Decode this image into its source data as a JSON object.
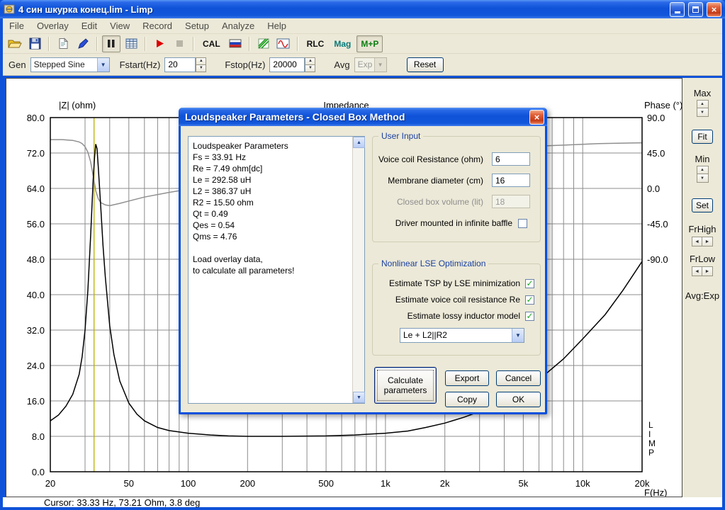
{
  "window": {
    "title": "4 син шкурка конец.lim - Limp"
  },
  "menu": {
    "items": [
      "File",
      "Overlay",
      "Edit",
      "View",
      "Record",
      "Setup",
      "Analyze",
      "Help"
    ]
  },
  "toolbar": {
    "cal_label": "CAL",
    "rlc_label": "RLC",
    "mag_label": "Mag",
    "mp_label": "M+P"
  },
  "genbar": {
    "gen_label": "Gen",
    "gen_value": "Stepped Sine",
    "fstart_label": "Fstart(Hz)",
    "fstart_value": "20",
    "fstop_label": "Fstop(Hz)",
    "fstop_value": "20000",
    "avg_label": "Avg",
    "avg_value": "Exp",
    "reset_label": "Reset"
  },
  "right_panel": {
    "max_label": "Max",
    "fit_label": "Fit",
    "min_label": "Min",
    "set_label": "Set",
    "frhigh_label": "FrHigh",
    "frlow_label": "FrLow",
    "avg_exp_label": "Avg:Exp"
  },
  "statusbar": {
    "cursor_text": "Cursor: 33.33 Hz, 73.21 Ohm, 3.8 deg"
  },
  "dialog": {
    "title": "Loudspeaker Parameters - Closed Box Method",
    "results_lines": [
      "Loudspeaker Parameters",
      "Fs  = 33.91 Hz",
      "Re  = 7.49 ohm[dc]",
      "Le  = 292.58 uH",
      "L2  = 386.37 uH",
      "R2  = 15.50 ohm",
      "Qt  = 0.49",
      "Qes = 0.54",
      "Qms = 4.76",
      "",
      "Load overlay data,",
      "to calculate all parameters!"
    ],
    "user_input": {
      "title": "User Input",
      "rows": [
        {
          "label": "Voice coil Resistance (ohm)",
          "value": "6"
        },
        {
          "label": "Membrane diameter (cm)",
          "value": "16"
        },
        {
          "label": "Closed box volume (lit)",
          "value": "18"
        }
      ],
      "baffle_label": "Driver mounted in infinite baffle",
      "baffle_checked": false
    },
    "lse": {
      "title": "Nonlinear LSE Optimization",
      "checks": [
        {
          "label": "Estimate TSP by LSE minimization",
          "checked": true
        },
        {
          "label": "Estimate voice coil resistance Re",
          "checked": true
        },
        {
          "label": "Estimate lossy inductor model",
          "checked": true
        }
      ],
      "model_value": "Le + L2||R2"
    },
    "buttons": {
      "calculate": "Calculate parameters",
      "export": "Export",
      "cancel": "Cancel",
      "copy": "Copy",
      "ok": "OK"
    }
  },
  "chart_data": {
    "type": "line",
    "title": "Impedance",
    "grid": true,
    "grid_color": "#8c8c8c",
    "y_left": {
      "label": "|Z| (ohm)",
      "min": 0,
      "max": 80,
      "ticks": [
        "80.0",
        "72.0",
        "64.0",
        "56.0",
        "48.0",
        "40.0",
        "32.0",
        "24.0",
        "16.0",
        "8.0",
        "0.0"
      ]
    },
    "y_right": {
      "label": "Phase (°)",
      "min": -90,
      "max": 90,
      "ticks": [
        "90.0",
        "45.0",
        "0.0",
        "-45.0",
        "-90.0"
      ]
    },
    "x_axis": {
      "label": "F(Hz)",
      "scale": "log",
      "min": 20,
      "max": 20000,
      "ticks": [
        [
          20,
          "20"
        ],
        [
          50,
          "50"
        ],
        [
          100,
          "100"
        ],
        [
          200,
          "200"
        ],
        [
          500,
          "500"
        ],
        [
          1000,
          "1k"
        ],
        [
          2000,
          "2k"
        ],
        [
          5000,
          "5k"
        ],
        [
          10000,
          "10k"
        ],
        [
          20000,
          "20k"
        ]
      ]
    },
    "cursor": {
      "freq_hz": 33.33,
      "impedance_ohm": 73.21,
      "phase_deg": 3.8,
      "color": "#b8b000"
    },
    "watermark": [
      "L",
      "I",
      "M",
      "P"
    ],
    "series": [
      {
        "name": "phase",
        "axis": "right",
        "color": "#8f8f8f",
        "points": [
          [
            20,
            62
          ],
          [
            23,
            62
          ],
          [
            26,
            61
          ],
          [
            28,
            59
          ],
          [
            29,
            57
          ],
          [
            30,
            53
          ],
          [
            31,
            46
          ],
          [
            32,
            34
          ],
          [
            33,
            16
          ],
          [
            33.5,
            6
          ],
          [
            34,
            -3
          ],
          [
            35,
            -13
          ],
          [
            36,
            -18
          ],
          [
            38,
            -21
          ],
          [
            40,
            -22
          ],
          [
            45,
            -19
          ],
          [
            50,
            -16
          ],
          [
            60,
            -11
          ],
          [
            80,
            -5
          ],
          [
            100,
            -1
          ],
          [
            150,
            5
          ],
          [
            200,
            10
          ],
          [
            300,
            17
          ],
          [
            500,
            25
          ],
          [
            700,
            30
          ],
          [
            1000,
            36
          ],
          [
            1500,
            42
          ],
          [
            2000,
            46
          ],
          [
            3000,
            50
          ],
          [
            5000,
            53
          ],
          [
            8000,
            55
          ],
          [
            12000,
            57
          ],
          [
            20000,
            58
          ]
        ]
      },
      {
        "name": "impedance",
        "axis": "left",
        "color": "#000000",
        "points": [
          [
            20,
            11.5
          ],
          [
            22,
            12.8
          ],
          [
            24,
            14.8
          ],
          [
            26,
            17.5
          ],
          [
            28,
            22
          ],
          [
            29,
            26
          ],
          [
            30,
            32
          ],
          [
            31,
            41
          ],
          [
            32,
            53
          ],
          [
            33,
            66
          ],
          [
            33.5,
            71
          ],
          [
            34,
            74
          ],
          [
            34.5,
            73
          ],
          [
            35,
            69
          ],
          [
            36,
            60
          ],
          [
            37,
            51
          ],
          [
            38,
            44
          ],
          [
            40,
            33
          ],
          [
            42,
            26.5
          ],
          [
            45,
            20.5
          ],
          [
            50,
            15.5
          ],
          [
            55,
            13
          ],
          [
            60,
            11.5
          ],
          [
            70,
            10
          ],
          [
            80,
            9.3
          ],
          [
            100,
            8.7
          ],
          [
            130,
            8.3
          ],
          [
            160,
            8.1
          ],
          [
            200,
            8
          ],
          [
            300,
            8
          ],
          [
            500,
            8.1
          ],
          [
            700,
            8.3
          ],
          [
            1000,
            8.7
          ],
          [
            1300,
            9.2
          ],
          [
            1600,
            10
          ],
          [
            2000,
            11
          ],
          [
            2500,
            12.3
          ],
          [
            3000,
            13.6
          ],
          [
            4000,
            16
          ],
          [
            5000,
            18.4
          ],
          [
            6000,
            20.8
          ],
          [
            8000,
            25.5
          ],
          [
            10000,
            30
          ],
          [
            13000,
            35.5
          ],
          [
            16000,
            41
          ],
          [
            20000,
            47.5
          ]
        ]
      }
    ]
  }
}
